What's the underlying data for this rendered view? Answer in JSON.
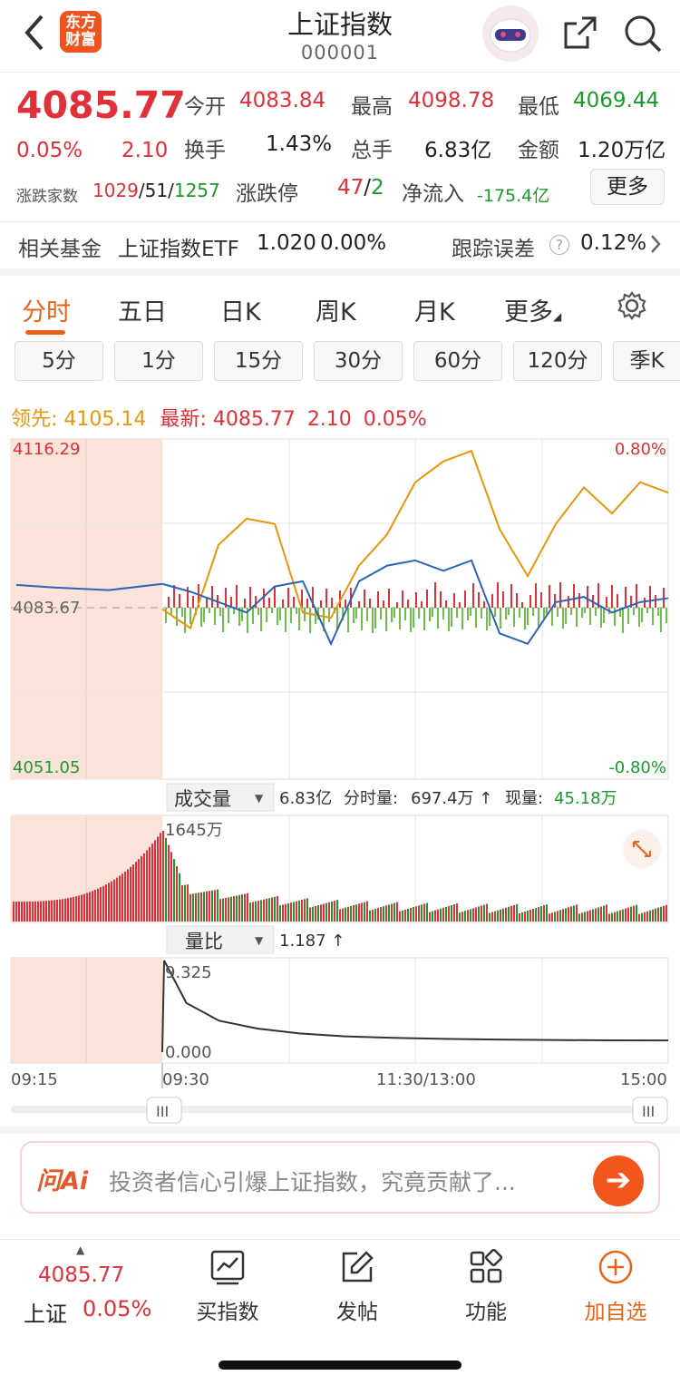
{
  "header": {
    "title": "上证指数",
    "code": "000001",
    "logo_text": "东方财富",
    "icons": [
      "back-arrow-icon",
      "assistant-robot-icon",
      "share-icon",
      "search-icon"
    ]
  },
  "quote": {
    "price": "4085.77",
    "change_pct": "0.05%",
    "change": "2.10",
    "open_label": "今开",
    "open": "4083.84",
    "high_label": "最高",
    "high": "4098.78",
    "low_label": "最低",
    "low": "4069.44",
    "turnover_label": "换手",
    "turnover": "1.43%",
    "volume_label": "总手",
    "volume": "6.83亿",
    "amount_label": "金额",
    "amount": "1.20万亿",
    "breadth_label": "涨跌家数",
    "up": "1029",
    "flat": "51",
    "down": "1257",
    "limit_label": "涨跌停",
    "limit_up": "47",
    "limit_down": "2",
    "inflow_label": "净流入",
    "inflow": "-175.4亿",
    "more": "更多"
  },
  "fund": {
    "label": "相关基金",
    "name": "上证指数ETF",
    "price": "1.020",
    "pct": "0.00%",
    "tracking_label": "跟踪误差",
    "tracking": "0.12%"
  },
  "tabs": [
    "分时",
    "五日",
    "日K",
    "周K",
    "月K",
    "更多"
  ],
  "intervals": [
    "5分",
    "1分",
    "15分",
    "30分",
    "60分",
    "120分",
    "季K"
  ],
  "summary": {
    "lead_label": "领先:",
    "lead": "4105.14",
    "latest_label": "最新:",
    "latest": "4085.77",
    "latest_change": "2.10",
    "latest_pct": "0.05%"
  },
  "volume_bar": {
    "selector": "成交量",
    "total": "6.83亿",
    "minute_label": "分时量:",
    "minute": "697.4万 ↑",
    "current_label": "现量:",
    "current": "45.18万",
    "peak_label": "1645万"
  },
  "ratio_bar": {
    "selector": "量比",
    "value": "1.187 ↑"
  },
  "time_axis": [
    "09:15",
    "09:30",
    "11:30/13:00",
    "15:00"
  ],
  "ai": {
    "logo": "问Ai",
    "placeholder": "投资者信心引爆上证指数，究竟贡献了..."
  },
  "bottom": {
    "price": "4085.77",
    "name": "上证",
    "pct": "0.05%",
    "items": [
      {
        "label": "买指数",
        "icon": "chart-icon"
      },
      {
        "label": "发帖",
        "icon": "edit-icon"
      },
      {
        "label": "功能",
        "icon": "grid-icon"
      },
      {
        "label": "加自选",
        "icon": "add-circle-icon"
      }
    ]
  },
  "chart_data": [
    {
      "type": "line",
      "title": "",
      "y_left_max": 4116.29,
      "y_left_min": 4051.05,
      "y_mid": 4083.67,
      "y_right_max": "0.80%",
      "y_right_min": "-0.80%",
      "x": [
        "09:15",
        "09:30",
        "11:30/13:00",
        "15:00"
      ],
      "series": [
        {
          "name": "",
          "color": "#e8960c",
          "values": [
            4083.67,
            4080,
            4096,
            4101,
            4100,
            4083,
            4082,
            4092,
            4098,
            4108,
            4112,
            4114,
            4099,
            4090,
            4100,
            4107,
            4102,
            4108,
            4106
          ]
        },
        {
          "name": "",
          "color": "#2d64b4",
          "values": [
            4088.5,
            4087,
            4085,
            4083,
            4088,
            4089,
            4077,
            4089,
            4092,
            4093,
            4091,
            4093,
            4079,
            4077,
            4085,
            4086,
            4083,
            4085,
            4085.77
          ]
        }
      ],
      "grid": true
    },
    {
      "type": "bar",
      "title": "成交量",
      "peak": "1645万",
      "total": "6.83亿"
    },
    {
      "type": "line",
      "title": "量比",
      "y_max": 9.325,
      "y_min": 0.0,
      "values": [
        9.325,
        5.0,
        3.2,
        2.4,
        1.9,
        1.6,
        1.45,
        1.35,
        1.28,
        1.23,
        1.2,
        1.187
      ]
    }
  ],
  "colors": {
    "up": "#e0303a",
    "down": "#1a9a2a",
    "accent": "#e6641a",
    "lead_line": "#e8960c",
    "price_line": "#2d64b4"
  }
}
